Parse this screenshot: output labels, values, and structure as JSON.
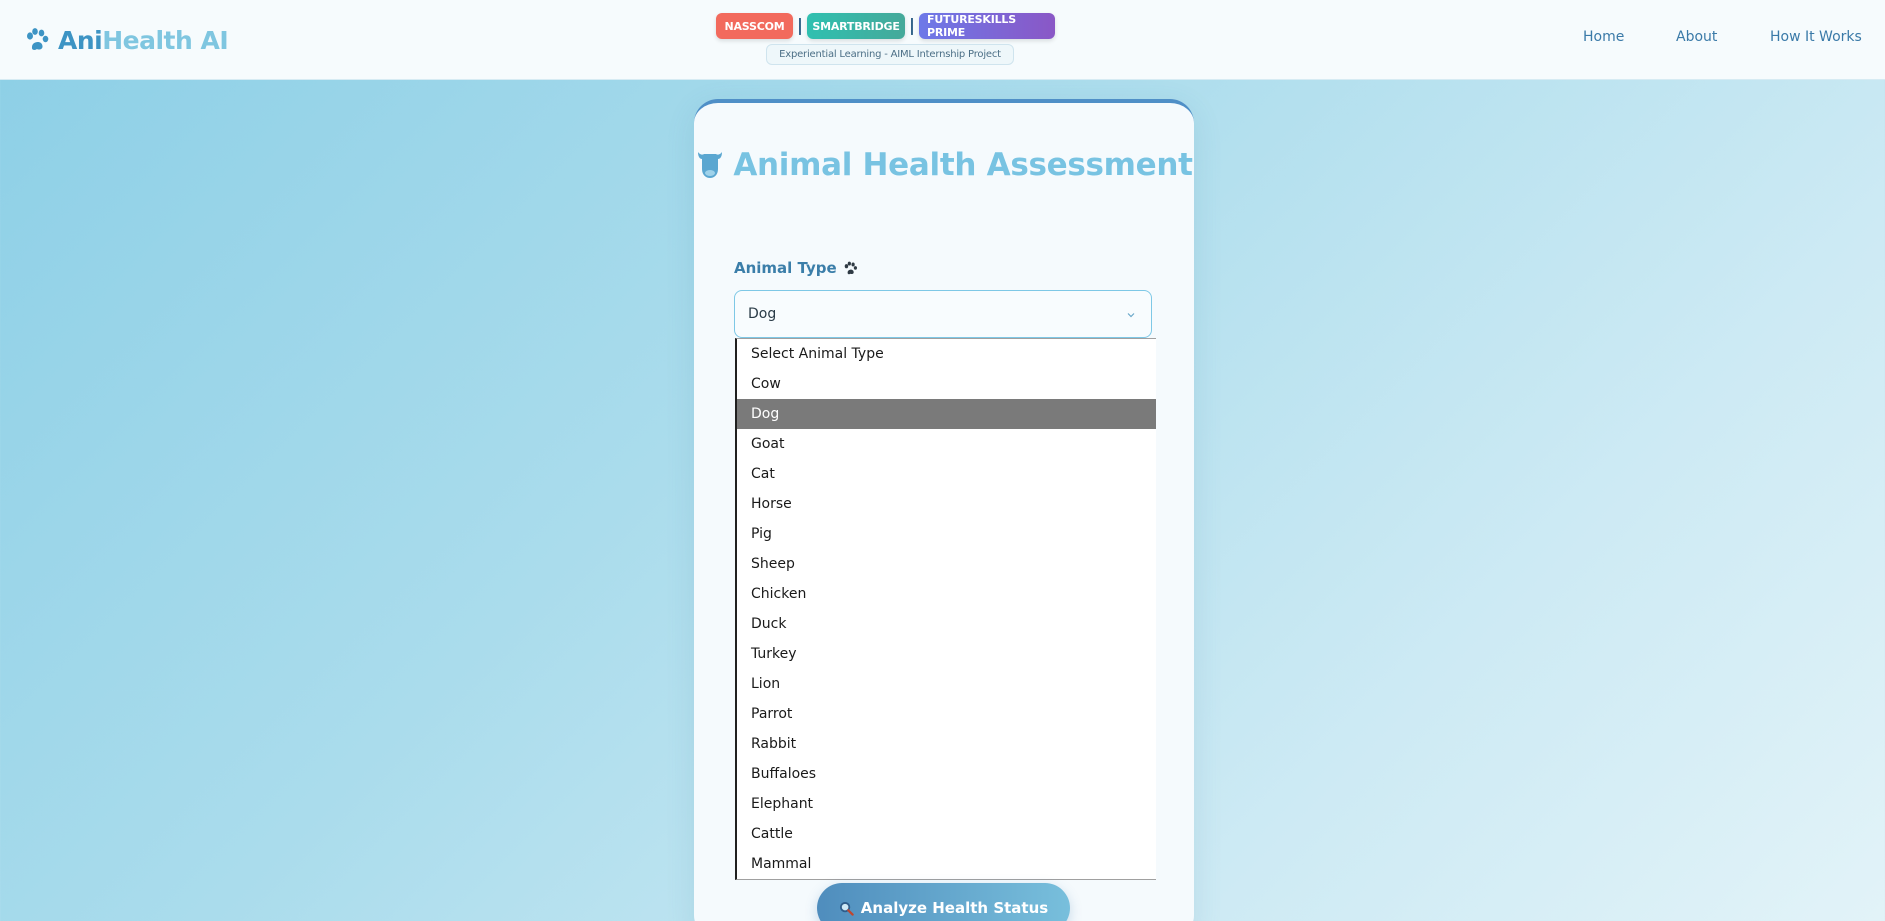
{
  "brand": {
    "name_part1": "Ani",
    "name_part2": "Health AI",
    "icon": "paw-icon"
  },
  "badges": {
    "nasscom": "NASSCOM",
    "smartbridge": "SMARTBRIDGE",
    "futureskills": "FUTURESKILLS PRIME",
    "separator": "|",
    "subtitle": "Experiential Learning - AIML Internship Project"
  },
  "nav": {
    "home": "Home",
    "about": "About",
    "how": "How It Works"
  },
  "card": {
    "title": "Animal Health Assessment",
    "title_icon": "cow-icon"
  },
  "form": {
    "animal_type_label": "Animal Type",
    "animal_type_value": "Dog",
    "options": [
      "Select Animal Type",
      "Cow",
      "Dog",
      "Goat",
      "Cat",
      "Horse",
      "Pig",
      "Sheep",
      "Chicken",
      "Duck",
      "Turkey",
      "Lion",
      "Parrot",
      "Rabbit",
      "Buffaloes",
      "Elephant",
      "Cattle",
      "Mammal"
    ],
    "selected_index": 2,
    "analyze_label": "Analyze Health Status",
    "analyze_icon": "magnifier-icon"
  },
  "colors": {
    "brand_dark": "#3d94c4",
    "brand_light": "#7fc6e0",
    "nasscom": "#f26a5d",
    "smartbridge": "#2fc0b0",
    "futureskills": "#7a6ad9",
    "selected_option": "#7a7a7a"
  }
}
